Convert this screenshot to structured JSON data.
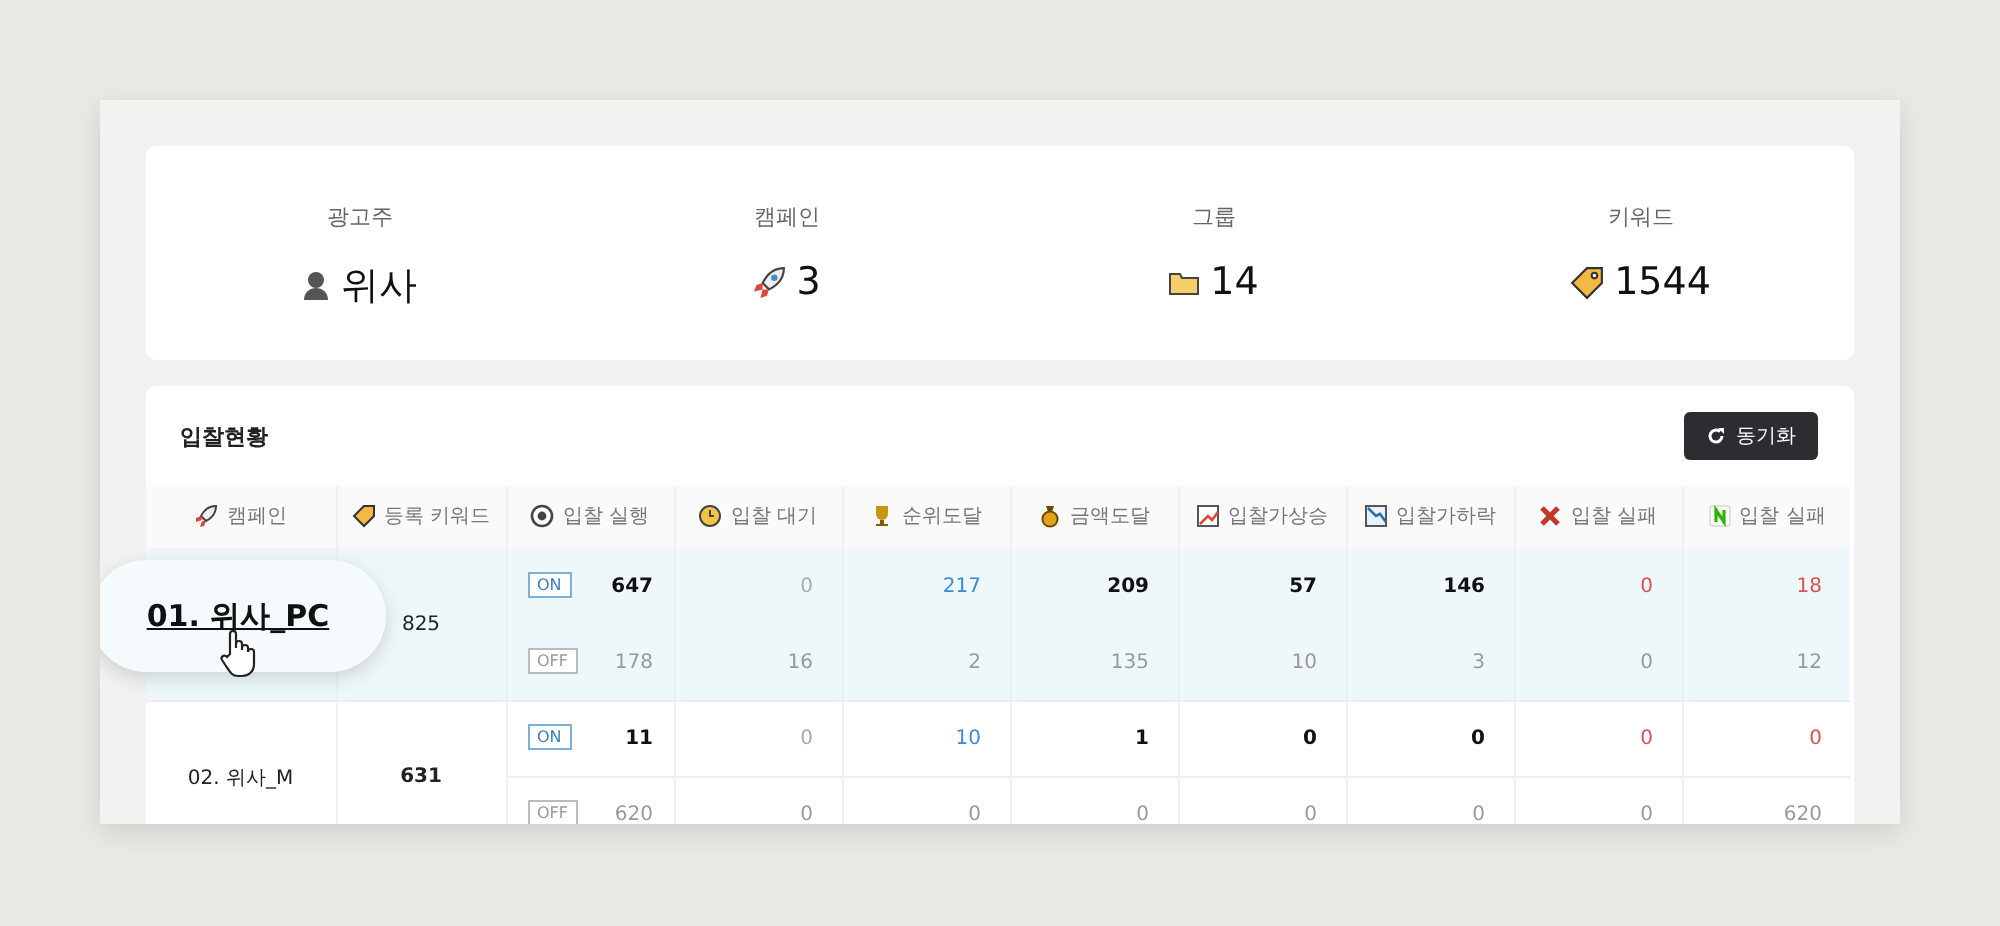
{
  "summary": [
    {
      "label": "광고주",
      "value": "위사"
    },
    {
      "label": "캠페인",
      "value": "3"
    },
    {
      "label": "그룹",
      "value": "14"
    },
    {
      "label": "키워드",
      "value": "1544"
    }
  ],
  "bid_status": {
    "title": "입찰현황",
    "sync_button": "동기화",
    "columns": [
      {
        "label": "캠페인"
      },
      {
        "label": "등록 키워드"
      },
      {
        "label": "입찰 실행"
      },
      {
        "label": "입찰 대기",
        "kind": "muted"
      },
      {
        "label": "순위도달",
        "kind": "rank"
      },
      {
        "label": "금액도달",
        "kind": "normal"
      },
      {
        "label": "입찰가상승",
        "kind": "normal"
      },
      {
        "label": "입찰가하락",
        "kind": "normal"
      },
      {
        "label": "입찰 실패",
        "kind": "fail"
      },
      {
        "label": "입찰 실패",
        "kind": "fail"
      }
    ],
    "rows": [
      {
        "campaign": "01. 위사_PC",
        "keywords": "825",
        "selected": true,
        "lines": [
          {
            "status": "ON",
            "kind": "on",
            "values": [
              "647",
              "0",
              "217",
              "209",
              "57",
              "146",
              "0",
              "18"
            ]
          },
          {
            "status": "OFF",
            "kind": "off",
            "values": [
              "178",
              "16",
              "2",
              "135",
              "10",
              "3",
              "0",
              "12"
            ]
          }
        ]
      },
      {
        "campaign": "02. 위사_M",
        "keywords": "631",
        "selected": false,
        "lines": [
          {
            "status": "ON",
            "kind": "on",
            "values": [
              "11",
              "0",
              "10",
              "1",
              "0",
              "0",
              "0",
              "0"
            ]
          },
          {
            "status": "OFF",
            "kind": "off",
            "values": [
              "620",
              "0",
              "0",
              "0",
              "0",
              "0",
              "0",
              "620"
            ]
          }
        ]
      }
    ]
  }
}
